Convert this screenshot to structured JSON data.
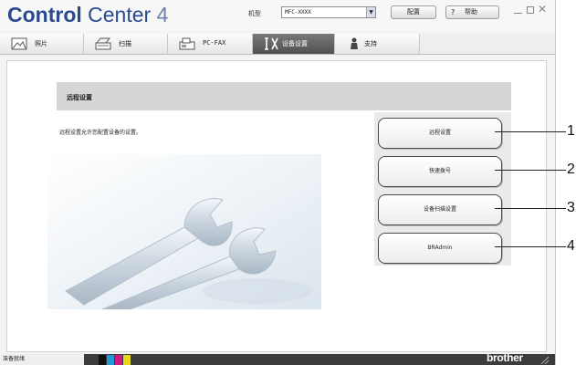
{
  "app": {
    "title_bold": "Control",
    "title_rest": "Center",
    "version": "4"
  },
  "titlebar": {
    "model_label": "机型",
    "model_value": "MFC-XXXX",
    "config_label": "配置",
    "help_icon": "?",
    "help_label": "帮助"
  },
  "tabs": [
    {
      "label": "照片",
      "icon": "photo-icon"
    },
    {
      "label": "扫描",
      "icon": "scanner-icon"
    },
    {
      "label": "PC-FAX",
      "icon": "fax-icon"
    },
    {
      "label": "设备设置",
      "icon": "device-settings-icon"
    },
    {
      "label": "支持",
      "icon": "support-icon"
    }
  ],
  "active_tab": "设备设置",
  "main": {
    "section_title": "远程设置",
    "section_desc": "远程设置允许您配置设备的设置。",
    "buttons": [
      {
        "label": "远程设置"
      },
      {
        "label": "快速拨号"
      },
      {
        "label": "设备扫描设置"
      },
      {
        "label": "BRAdmin"
      }
    ]
  },
  "callouts": [
    "1",
    "2",
    "3",
    "4"
  ],
  "status": {
    "text": "准备就绪",
    "brand": "brother",
    "ink_levels": [
      {
        "name": "black",
        "color": "#111111",
        "level": 1.0
      },
      {
        "name": "cyan",
        "color": "#1e9ad6",
        "level": 1.0
      },
      {
        "name": "magenta",
        "color": "#d11a7d",
        "level": 1.0
      },
      {
        "name": "yellow",
        "color": "#e8d61a",
        "level": 1.0
      }
    ]
  },
  "colors": {
    "brand_blue": "#2b4a8e",
    "active_tab": "#555555"
  }
}
